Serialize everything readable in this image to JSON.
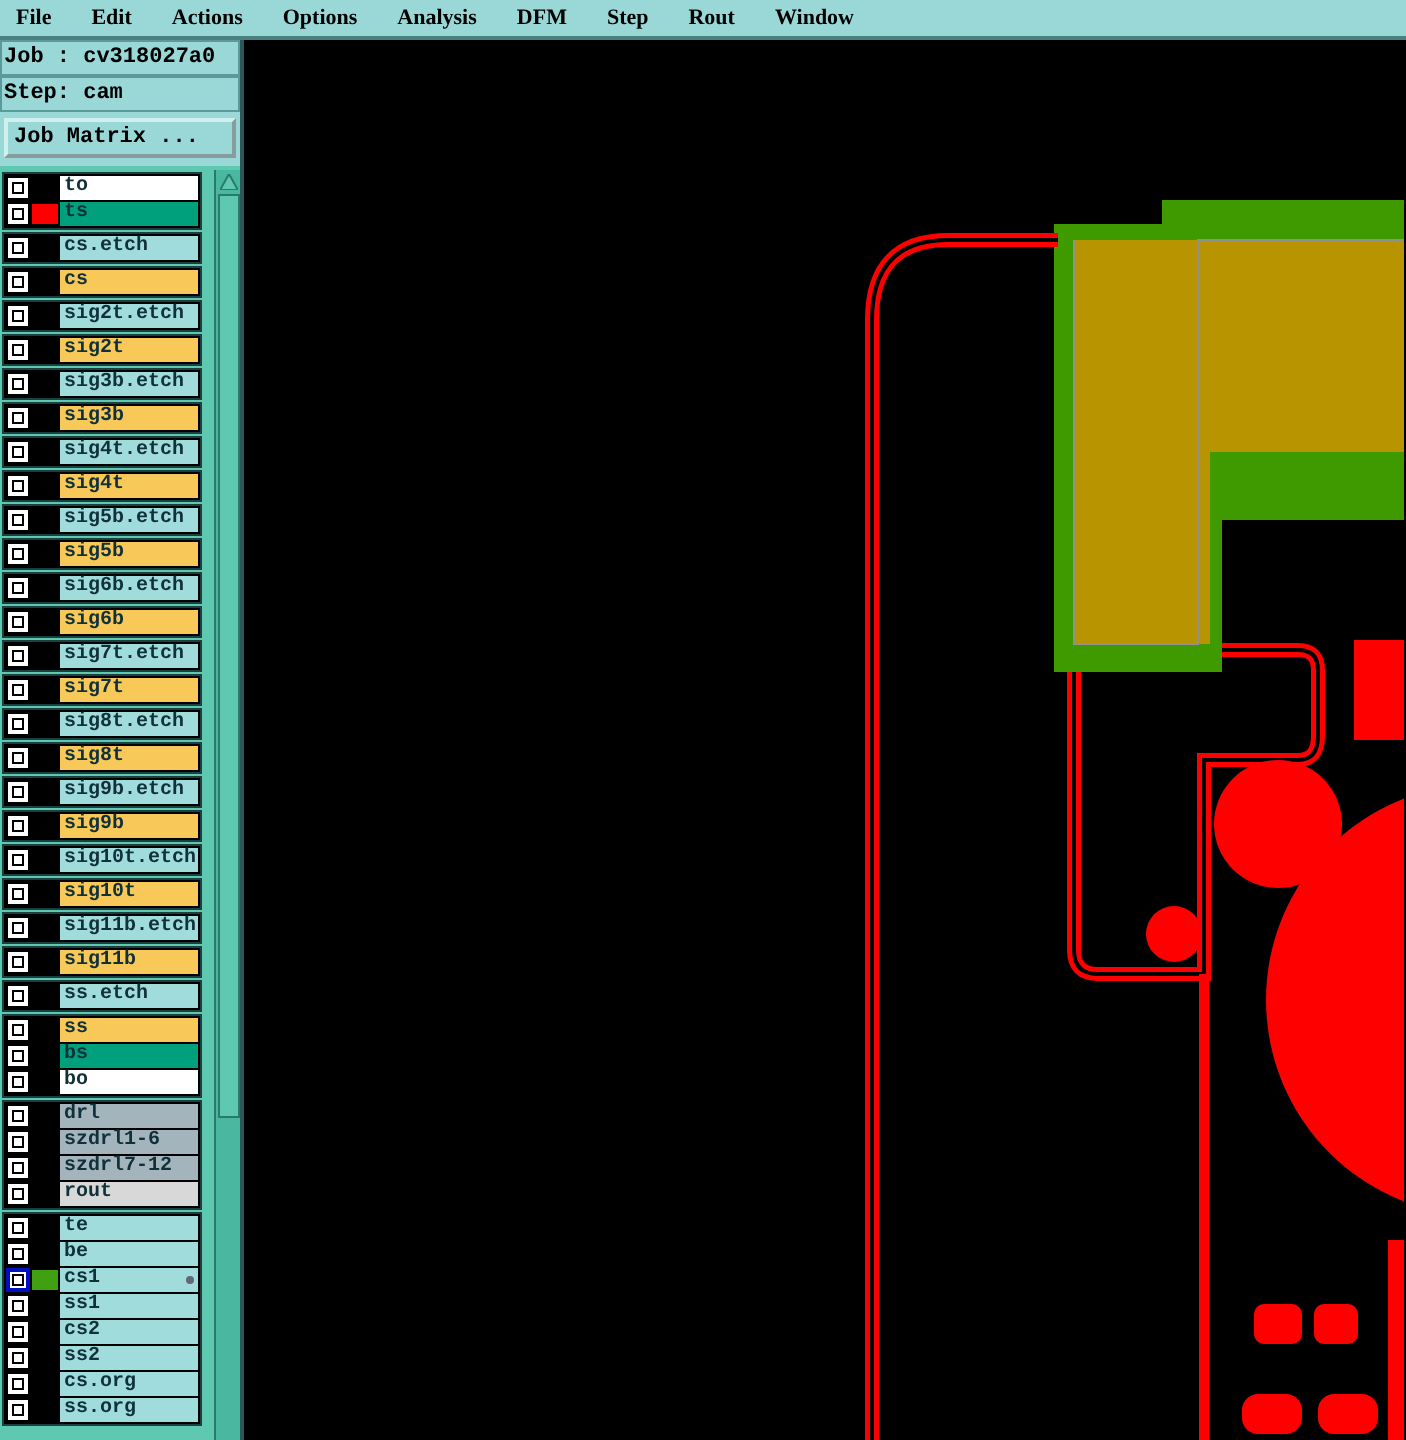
{
  "menu": [
    "File",
    "Edit",
    "Actions",
    "Options",
    "Analysis",
    "DFM",
    "Step",
    "Rout",
    "Window"
  ],
  "job": {
    "label": "Job :",
    "value": "cv318027a0"
  },
  "step": {
    "label": "Step:",
    "value": "cam"
  },
  "job_matrix_button": "Job Matrix ...",
  "layer_groups": [
    {
      "layers": [
        {
          "name": "to",
          "color": "#ffffff",
          "checked": true,
          "work": false
        },
        {
          "name": "ts",
          "color": "#00a07c",
          "swatch": {
            "color": "#ff0000"
          },
          "checked": true,
          "work": false
        }
      ]
    },
    {
      "layers": [
        {
          "name": "cs.etch",
          "color": "#a0dcdc",
          "checked": true,
          "work": false
        }
      ]
    },
    {
      "layers": [
        {
          "name": "cs",
          "color": "#f8c858",
          "checked": true,
          "work": false
        }
      ]
    },
    {
      "layers": [
        {
          "name": "sig2t.etch",
          "color": "#a0dcdc",
          "checked": true,
          "work": false
        }
      ]
    },
    {
      "layers": [
        {
          "name": "sig2t",
          "color": "#f8c858",
          "checked": true,
          "work": false
        }
      ]
    },
    {
      "layers": [
        {
          "name": "sig3b.etch",
          "color": "#a0dcdc",
          "checked": true,
          "work": false
        }
      ]
    },
    {
      "layers": [
        {
          "name": "sig3b",
          "color": "#f8c858",
          "checked": true,
          "work": false
        }
      ]
    },
    {
      "layers": [
        {
          "name": "sig4t.etch",
          "color": "#a0dcdc",
          "checked": true,
          "work": false
        }
      ]
    },
    {
      "layers": [
        {
          "name": "sig4t",
          "color": "#f8c858",
          "checked": true,
          "work": false
        }
      ]
    },
    {
      "layers": [
        {
          "name": "sig5b.etch",
          "color": "#a0dcdc",
          "checked": true,
          "work": false
        }
      ]
    },
    {
      "layers": [
        {
          "name": "sig5b",
          "color": "#f8c858",
          "checked": true,
          "work": false
        }
      ]
    },
    {
      "layers": [
        {
          "name": "sig6b.etch",
          "color": "#a0dcdc",
          "checked": true,
          "work": false
        }
      ]
    },
    {
      "layers": [
        {
          "name": "sig6b",
          "color": "#f8c858",
          "checked": true,
          "work": false
        }
      ]
    },
    {
      "layers": [
        {
          "name": "sig7t.etch",
          "color": "#a0dcdc",
          "checked": true,
          "work": false
        }
      ]
    },
    {
      "layers": [
        {
          "name": "sig7t",
          "color": "#f8c858",
          "checked": true,
          "work": false
        }
      ]
    },
    {
      "layers": [
        {
          "name": "sig8t.etch",
          "color": "#a0dcdc",
          "checked": true,
          "work": false
        }
      ]
    },
    {
      "layers": [
        {
          "name": "sig8t",
          "color": "#f8c858",
          "checked": true,
          "work": false
        }
      ]
    },
    {
      "layers": [
        {
          "name": "sig9b.etch",
          "color": "#a0dcdc",
          "checked": true,
          "work": false
        }
      ]
    },
    {
      "layers": [
        {
          "name": "sig9b",
          "color": "#f8c858",
          "checked": true,
          "work": false
        }
      ]
    },
    {
      "layers": [
        {
          "name": "sig10t.etch",
          "color": "#a0dcdc",
          "checked": true,
          "work": false
        }
      ]
    },
    {
      "layers": [
        {
          "name": "sig10t",
          "color": "#f8c858",
          "checked": true,
          "work": false
        }
      ]
    },
    {
      "layers": [
        {
          "name": "sig11b.etch",
          "color": "#a0dcdc",
          "checked": true,
          "work": false
        }
      ]
    },
    {
      "layers": [
        {
          "name": "sig11b",
          "color": "#f8c858",
          "checked": true,
          "work": false
        }
      ]
    },
    {
      "layers": [
        {
          "name": "ss.etch",
          "color": "#a0dcdc",
          "checked": true,
          "work": false
        }
      ]
    },
    {
      "layers": [
        {
          "name": "ss",
          "color": "#f8c858",
          "checked": true,
          "work": false
        },
        {
          "name": "bs",
          "color": "#00a07c",
          "checked": true,
          "work": false
        },
        {
          "name": "bo",
          "color": "#ffffff",
          "checked": true,
          "work": false
        }
      ]
    },
    {
      "layers": [
        {
          "name": "drl",
          "color": "#a4b4bc",
          "checked": true,
          "work": false
        },
        {
          "name": "szdrl1-6",
          "color": "#a4b4bc",
          "checked": true,
          "work": false
        },
        {
          "name": "szdrl7-12",
          "color": "#a4b4bc",
          "checked": true,
          "work": false
        },
        {
          "name": "rout",
          "color": "#d8d8d8",
          "checked": true,
          "work": false
        }
      ]
    },
    {
      "layers": [
        {
          "name": "te",
          "color": "#a0dcdc",
          "checked": true,
          "work": false
        },
        {
          "name": "be",
          "color": "#a0dcdc",
          "checked": true,
          "work": false
        },
        {
          "name": "cs1",
          "color": "#a0dcdc",
          "swatch": {
            "color": "#40a010"
          },
          "checked": true,
          "work": true
        },
        {
          "name": "ss1",
          "color": "#a0dcdc",
          "checked": true,
          "work": false
        },
        {
          "name": "cs2",
          "color": "#a0dcdc",
          "checked": true,
          "work": false
        },
        {
          "name": "ss2",
          "color": "#a0dcdc",
          "checked": true,
          "work": false
        },
        {
          "name": "cs.org",
          "color": "#a0dcdc",
          "checked": true,
          "work": false
        },
        {
          "name": "ss.org",
          "color": "#a0dcdc",
          "checked": true,
          "work": false
        }
      ]
    }
  ]
}
